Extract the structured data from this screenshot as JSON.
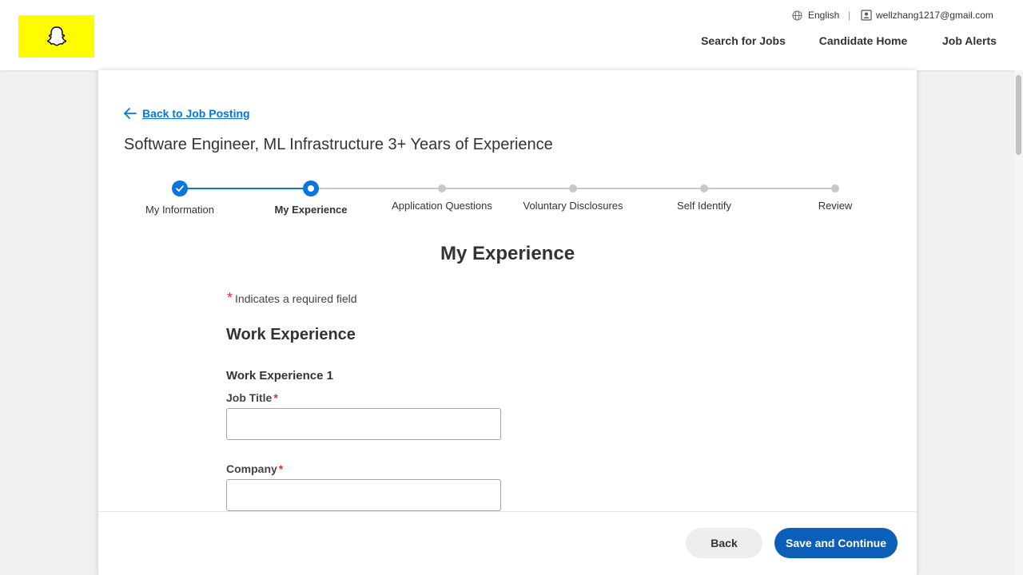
{
  "header": {
    "logo_icon": "snapchat-ghost-icon",
    "language": "English",
    "separator": "|",
    "user_email": "wellzhang1217@gmail.com",
    "nav": {
      "search_jobs": "Search for Jobs",
      "candidate_home": "Candidate Home",
      "job_alerts": "Job Alerts"
    }
  },
  "page": {
    "back_link": "Back to Job Posting",
    "job_title": "Software Engineer, ML Infrastructure 3+ Years of Experience"
  },
  "progress": {
    "steps": [
      {
        "label": "My Information",
        "status": "done"
      },
      {
        "label": "My Experience",
        "status": "current"
      },
      {
        "label": "Application Questions",
        "status": "future"
      },
      {
        "label": "Voluntary Disclosures",
        "status": "future"
      },
      {
        "label": "Self Identify",
        "status": "future"
      },
      {
        "label": "Review",
        "status": "future"
      }
    ],
    "accent_color": "#0875e1"
  },
  "form": {
    "section_title": "My Experience",
    "required_star": "*",
    "required_note": "Indicates a required field",
    "work_experience_heading": "Work Experience",
    "work_experience_1_heading": "Work Experience 1",
    "job_title_label": "Job Title",
    "job_title_value": "",
    "company_label": "Company",
    "company_value": ""
  },
  "footer": {
    "back_button": "Back",
    "save_button": "Save and Continue"
  }
}
